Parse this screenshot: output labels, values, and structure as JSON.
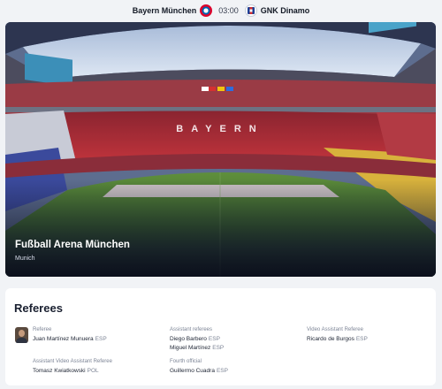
{
  "match": {
    "home_team": "Bayern München",
    "away_team": "GNK Dinamo",
    "time": "03:00"
  },
  "venue": {
    "name": "Fußball Arena München",
    "city": "Munich",
    "stand_text": "BAYERN"
  },
  "referees": {
    "title": "Referees",
    "groups": [
      {
        "role": "Referee",
        "people": [
          {
            "name": "Juan Martínez Munuera",
            "nationality": "ESP"
          }
        ]
      },
      {
        "role": "Assistant referees",
        "people": [
          {
            "name": "Diego Barbero",
            "nationality": "ESP"
          },
          {
            "name": "Miguel Martínez",
            "nationality": "ESP"
          }
        ]
      },
      {
        "role": "Video Assistant Referee",
        "people": [
          {
            "name": "Ricardo de Burgos",
            "nationality": "ESP"
          }
        ]
      },
      {
        "role": "Assistant Video Assistant Referee",
        "people": [
          {
            "name": "Tomasz Kwiatkowski",
            "nationality": "POL"
          }
        ]
      },
      {
        "role": "Fourth official",
        "people": [
          {
            "name": "Guillermo Cuadra",
            "nationality": "ESP"
          }
        ]
      }
    ]
  },
  "colors": {
    "bayern_red": "#dc052d",
    "dinamo_blue": "#1c3f95",
    "page_background": "#f1f3f6"
  },
  "icons": {
    "home_crest": "bayern-crest-icon",
    "away_crest": "dinamo-crest-icon"
  }
}
